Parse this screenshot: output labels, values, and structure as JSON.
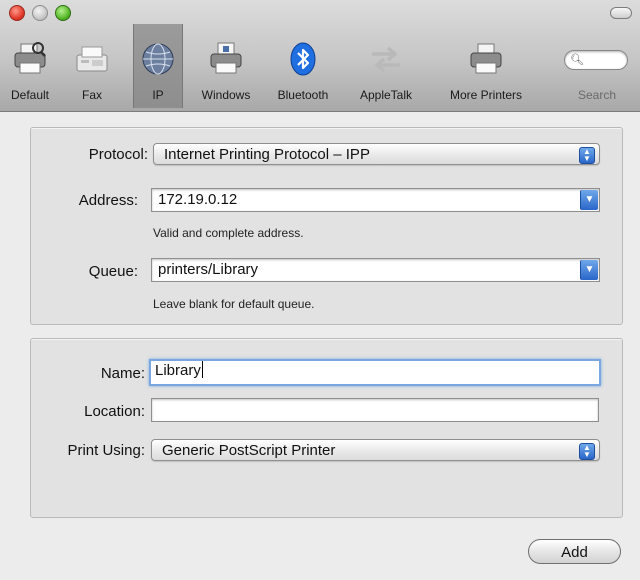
{
  "toolbar": {
    "items": [
      {
        "label": "Default",
        "icon": "printer-default-icon"
      },
      {
        "label": "Fax",
        "icon": "fax-icon"
      },
      {
        "label": "IP",
        "icon": "globe-icon"
      },
      {
        "label": "Windows",
        "icon": "windows-printer-icon"
      },
      {
        "label": "Bluetooth",
        "icon": "bluetooth-icon"
      },
      {
        "label": "AppleTalk",
        "icon": "appletalk-icon"
      },
      {
        "label": "More Printers",
        "icon": "printer-icon"
      }
    ],
    "search_label": "Search",
    "selected": "IP"
  },
  "connection": {
    "protocol_label": "Protocol:",
    "protocol_value": "Internet Printing Protocol – IPP",
    "address_label": "Address:",
    "address_value": "172.19.0.12",
    "address_hint": "Valid and complete address.",
    "queue_label": "Queue:",
    "queue_value": "printers/Library",
    "queue_hint": "Leave blank for default queue."
  },
  "printer": {
    "name_label": "Name:",
    "name_value": "Library",
    "location_label": "Location:",
    "location_value": "",
    "print_using_label": "Print Using:",
    "print_using_value": "Generic PostScript Printer"
  },
  "actions": {
    "add_label": "Add"
  },
  "colors": {
    "accent": "#2a66c9",
    "focus_ring": "#7aa7e0",
    "bluetooth": "#1f6fe0"
  }
}
